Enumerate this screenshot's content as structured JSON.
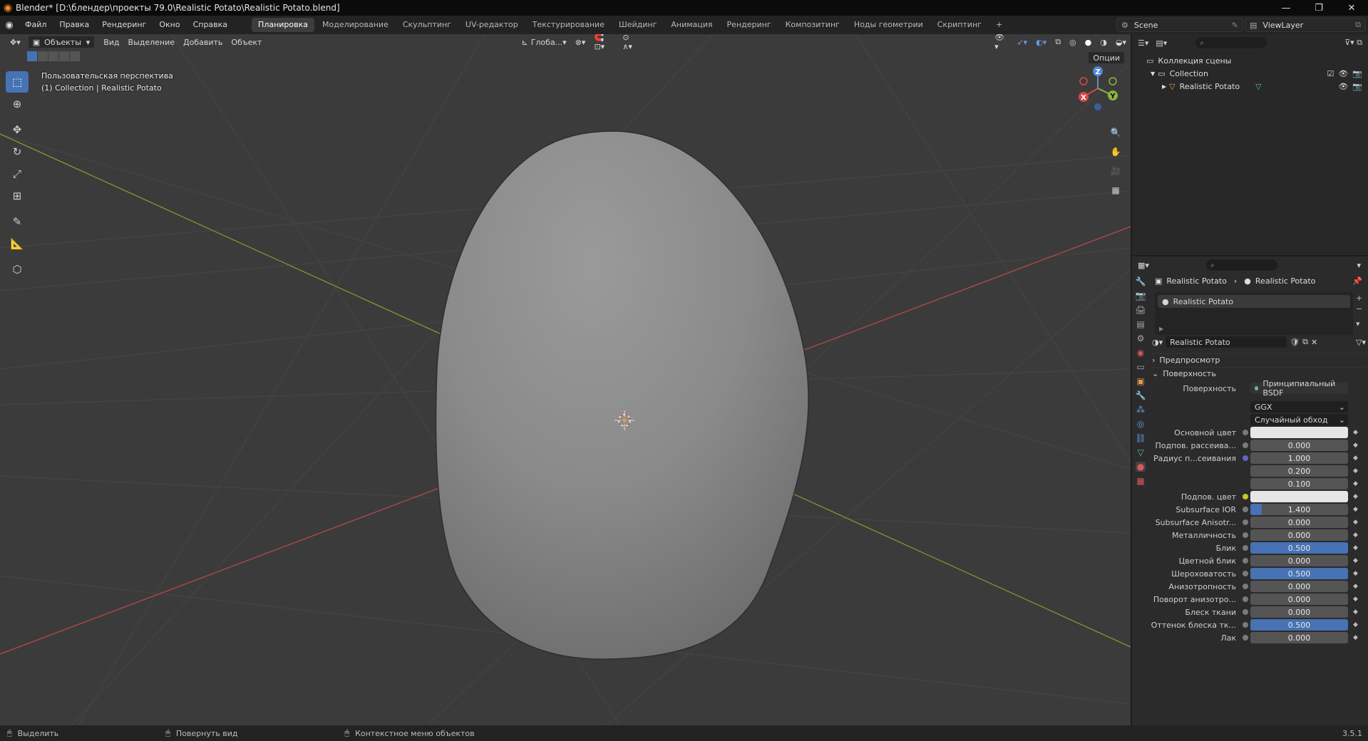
{
  "window": {
    "title": "Blender* [D:\\блендер\\проекты 79.0\\Realistic Potato\\Realistic Potato.blend]",
    "controls": [
      "—",
      "❐",
      "✕"
    ]
  },
  "menu": [
    "Файл",
    "Правка",
    "Рендеринг",
    "Окно",
    "Справка"
  ],
  "workspaces": {
    "active_index": 0,
    "tabs": [
      "Планировка",
      "Моделирование",
      "Скульптинг",
      "UV-редактор",
      "Текстурирование",
      "Шейдинг",
      "Анимация",
      "Рендеринг",
      "Композитинг",
      "Ноды геометрии",
      "Скриптинг",
      "+"
    ]
  },
  "scene": {
    "name": "Scene",
    "view_layer": "ViewLayer"
  },
  "viewport": {
    "mode": "Объекты",
    "menus": [
      "Вид",
      "Выделение",
      "Добавить",
      "Объект"
    ],
    "transform_orientation": "Глоба...",
    "options": "Опции",
    "overlay_line1": "Пользовательская перспектива",
    "overlay_line2": "(1) Collection | Realistic Potato",
    "gizmo": {
      "z": "Z",
      "y": "Y",
      "x": "X"
    }
  },
  "outliner": {
    "scene_collection": "Коллекция сцены",
    "collection": "Collection",
    "object": "Realistic Potato"
  },
  "properties": {
    "breadcrumb_object": "Realistic Potato",
    "breadcrumb_material": "Realistic Potato",
    "slot": "Realistic Potato",
    "material_name": "Realistic Potato",
    "panel_preview": "Предпросмотр",
    "panel_surface": "Поверхность",
    "surface_label": "Поверхность",
    "surface_value": "Принципиальный BSDF",
    "distribution": "GGX",
    "subsurface_method": "Случайный обход",
    "rows": [
      {
        "label": "Основной цвет",
        "type": "color",
        "color": "#e6e6e6"
      },
      {
        "label": "Подпов. рассеива...",
        "value": "0.000",
        "fill": 0,
        "dot": "#7a7a7a"
      },
      {
        "label": "Радиус п...сеивания",
        "value": "1.000",
        "fill": 0,
        "dot": "#6363c7"
      },
      {
        "label": "",
        "value": "0.200",
        "fill": 0,
        "sub": true
      },
      {
        "label": "",
        "value": "0.100",
        "fill": 0,
        "sub": true
      },
      {
        "label": "Подпов. цвет",
        "type": "color",
        "color": "#e6e6e6",
        "dot": "#c7c729"
      },
      {
        "label": "Subsurface IOR",
        "value": "1.400",
        "fill": 0.12
      },
      {
        "label": "Subsurface Anisotr...",
        "value": "0.000",
        "fill": 0
      },
      {
        "label": "Металличность",
        "value": "0.000",
        "fill": 0
      },
      {
        "label": "Блик",
        "value": "0.500",
        "fill": 1
      },
      {
        "label": "Цветной блик",
        "value": "0.000",
        "fill": 0
      },
      {
        "label": "Шероховатость",
        "value": "0.500",
        "fill": 1
      },
      {
        "label": "Анизотропность",
        "value": "0.000",
        "fill": 0
      },
      {
        "label": "Поворот анизотро...",
        "value": "0.000",
        "fill": 0
      },
      {
        "label": "Блеск ткани",
        "value": "0.000",
        "fill": 0
      },
      {
        "label": "Оттенок блеска тк...",
        "value": "0.500",
        "fill": 1
      },
      {
        "label": "Лак",
        "value": "0.000",
        "fill": 0
      }
    ]
  },
  "statusbar": {
    "left": "Выделить",
    "middle": "Повернуть вид",
    "right": "Контекстное меню объектов",
    "version": "3.5.1"
  },
  "colors": {
    "accent": "#4772b3",
    "grid_x_axis": "#c74b4b",
    "grid_y_axis": "#7a9a32"
  }
}
